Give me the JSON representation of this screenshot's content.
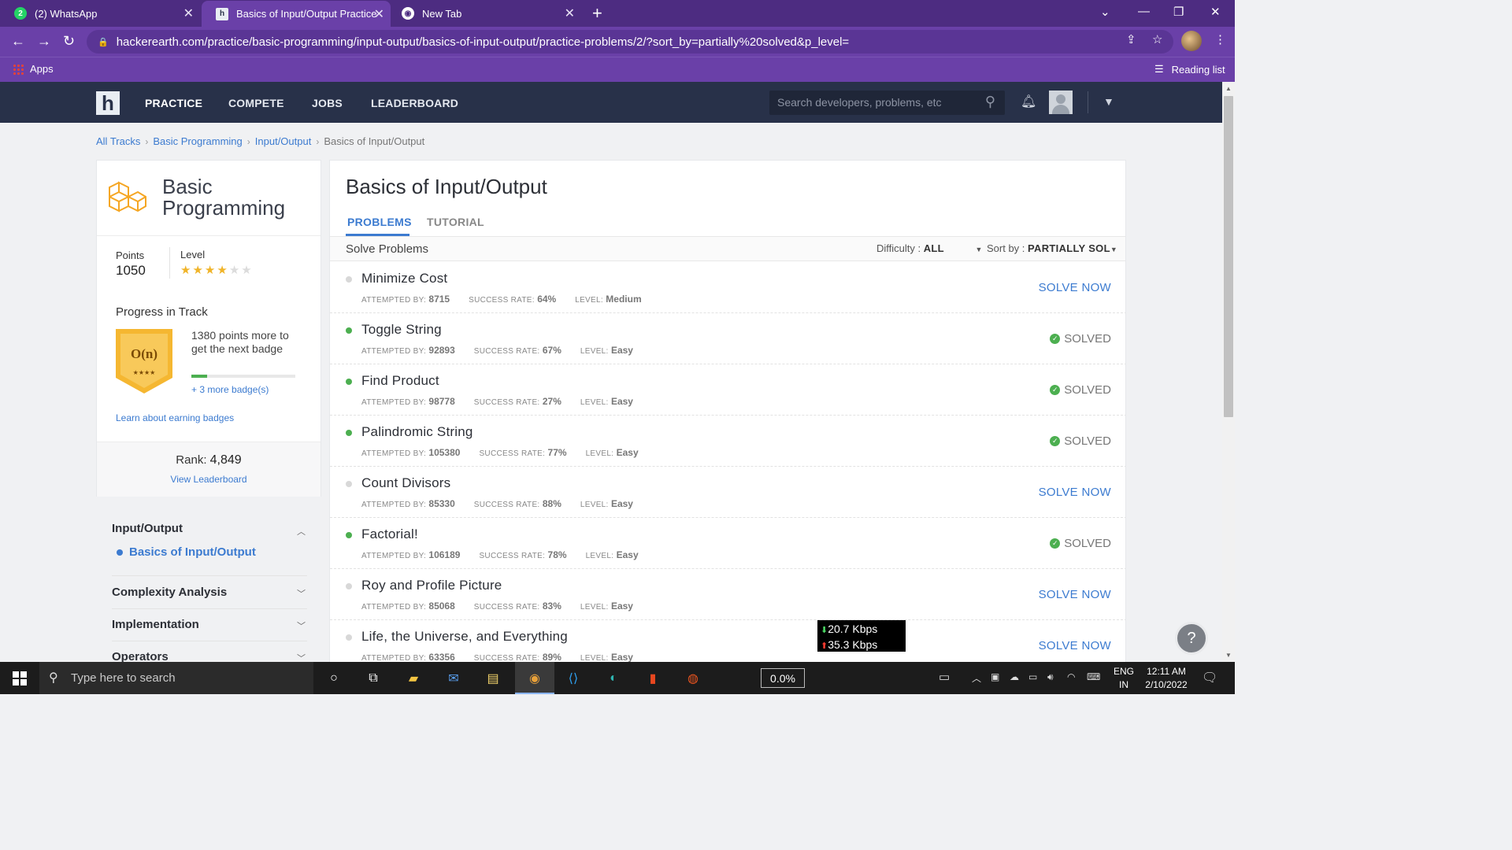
{
  "browser": {
    "tabs": [
      {
        "title": "(2) WhatsApp",
        "favicon": "whatsapp-icon",
        "active": false
      },
      {
        "title": "Basics of Input/Output Practice P",
        "favicon": "hackerearth-icon",
        "active": true
      },
      {
        "title": "New Tab",
        "favicon": "chrome-icon",
        "active": false
      }
    ],
    "url": "hackerearth.com/practice/basic-programming/input-output/basics-of-input-output/practice-problems/2/?sort_by=partially%20solved&p_level=",
    "bookmarks": {
      "apps": "Apps",
      "reading_list": "Reading list"
    }
  },
  "site": {
    "logo": "h",
    "nav": [
      "PRACTICE",
      "COMPETE",
      "JOBS",
      "LEADERBOARD"
    ],
    "search_placeholder": "Search developers, problems, etc"
  },
  "breadcrumb": [
    "All Tracks",
    "Basic Programming",
    "Input/Output",
    "Basics of Input/Output"
  ],
  "track": {
    "title": "Basic Programming",
    "points_label": "Points",
    "points": "1050",
    "level_label": "Level",
    "stars_filled": 4,
    "stars_total": 6,
    "progress_title": "Progress in Track",
    "badge_symbol": "O(n)",
    "badge_stars": "★★★★",
    "next_badge_text": "1380 points more to get the next badge",
    "progress_fraction": 0.15,
    "more_badges": "+ 3 more badge(s)",
    "learn_link": "Learn about earning badges",
    "rank_label": "Rank:",
    "rank": "4,849",
    "leaderboard_link": "View Leaderboard"
  },
  "sidenav": {
    "active_section": "Input/Output",
    "active_item": "Basics of Input/Output",
    "sections": [
      "Complexity Analysis",
      "Implementation",
      "Operators"
    ]
  },
  "main": {
    "title": "Basics of Input/Output",
    "tabs": [
      "PROBLEMS",
      "TUTORIAL"
    ],
    "solve_label": "Solve Problems",
    "difficulty_label": "Difficulty :",
    "difficulty_value": "ALL",
    "sort_label": "Sort by :",
    "sort_value": "PARTIALLY SOL",
    "meta_labels": {
      "attempted": "ATTEMPTED BY:",
      "success": "SUCCESS RATE:",
      "level": "LEVEL:"
    },
    "solve_now_label": "SOLVE NOW",
    "solved_label": "SOLVED",
    "problems": [
      {
        "name": "Minimize Cost",
        "attempted": "8715",
        "success": "64%",
        "level": "Medium",
        "solved": false
      },
      {
        "name": "Toggle String",
        "attempted": "92893",
        "success": "67%",
        "level": "Easy",
        "solved": true
      },
      {
        "name": "Find Product",
        "attempted": "98778",
        "success": "27%",
        "level": "Easy",
        "solved": true
      },
      {
        "name": "Palindromic String",
        "attempted": "105380",
        "success": "77%",
        "level": "Easy",
        "solved": true
      },
      {
        "name": "Count Divisors",
        "attempted": "85330",
        "success": "88%",
        "level": "Easy",
        "solved": false
      },
      {
        "name": "Factorial!",
        "attempted": "106189",
        "success": "78%",
        "level": "Easy",
        "solved": true
      },
      {
        "name": "Roy and Profile Picture",
        "attempted": "85068",
        "success": "83%",
        "level": "Easy",
        "solved": false
      },
      {
        "name": "Life, the Universe, and Everything",
        "attempted": "63356",
        "success": "89%",
        "level": "Easy",
        "solved": false
      }
    ]
  },
  "overlay": {
    "down": "20.7 Kbps",
    "up": "35.3 Kbps",
    "help": "?"
  },
  "taskbar": {
    "search_placeholder": "Type here to search",
    "cpu": "0.0%",
    "lang_top": "ENG",
    "lang_bottom": "IN",
    "time": "12:11 AM",
    "date": "2/10/2022"
  },
  "colors": {
    "brand_purple": "#6a40a8",
    "header_navy": "#283149",
    "link_blue": "#3c7bd0",
    "solved_green": "#4caf50"
  }
}
